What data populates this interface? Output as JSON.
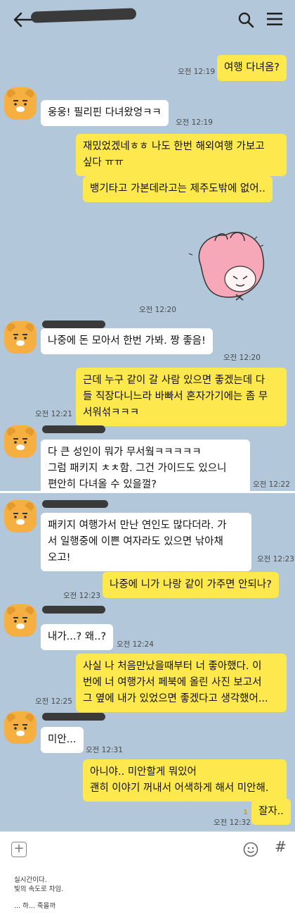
{
  "colors": {
    "chat_background": "#b2c7d9",
    "my_bubble": "#fde84d",
    "their_bubble": "#ffffff",
    "avatar": "#f5b041"
  },
  "header": {
    "back_icon": "arrow-left",
    "search_icon": "search",
    "menu_icon": "hamburger"
  },
  "messages": [
    {
      "id": "m1",
      "from": "me",
      "text": "여행 다녀옴?",
      "time": "오전 12:19"
    },
    {
      "id": "m2",
      "from": "them",
      "text": "웅웅! 필리핀 다녀왔엉ㅋㅋ",
      "time": "오전 12:19"
    },
    {
      "id": "m3",
      "from": "me",
      "text": "재밌었겠네ㅎㅎ 나도 한번 해외여행 가보고\n싶다 ㅠㅠ"
    },
    {
      "id": "m4",
      "from": "me",
      "text": "뱅기타고 가본데라고는 제주도밖에 없어.."
    },
    {
      "id": "m5",
      "from": "me",
      "sticker": "pink-bunny-sticker",
      "time": "오전 12:20"
    },
    {
      "id": "m6",
      "from": "them",
      "text": "나중에 돈 모아서 한번 가봐. 짱 좋음!",
      "time": "오전 12:20"
    },
    {
      "id": "m7",
      "from": "me",
      "text": "근데 누구 같이 갈 사람 있으면 좋겠는데 다\n들 직장다니느라 바빠서 혼자가기에는 좀 무\n서워섞ㅋㅋㅋ",
      "time": "오전 12:21"
    },
    {
      "id": "m8",
      "from": "them",
      "text": "다 큰 성인이 뭐가 무서웤ㅋㅋㅋㅋㅋ\n그럼 패키지 ㅊㅊ함. 그건 가이드도 있으니\n편안히 다녀올 수 있을껄?",
      "time": "오전 12:22"
    },
    {
      "id": "m9",
      "from": "them",
      "text": "패키지 여행가서 만난 연인도 많다더라. 가\n서 일행중에 이쁜 여자라도 있으면 낚아채\n오고!",
      "time": "오전 12:23"
    },
    {
      "id": "m10",
      "from": "me",
      "text": "나중에 니가 나랑 같이 가주면 안되나?",
      "time": "오전 12:23"
    },
    {
      "id": "m11",
      "from": "them",
      "text": "내가...? 왜..?",
      "time": "오전 12:24"
    },
    {
      "id": "m12",
      "from": "me",
      "text": "사실 나 처음만났을때부터 너 좋아했다. 이\n번에 너 여행가서 페북에 올린 사진 보고서\n그 옆에 내가 있었으면 좋겠다고 생각했어...",
      "time": "오전 12:25"
    },
    {
      "id": "m13",
      "from": "them",
      "text": "미안...",
      "time": "오전 12:31"
    },
    {
      "id": "m14",
      "from": "me",
      "text": "아니야.. 미안할게 뭐있어\n괜히 이야기 꺼내서 어색하게 해서 미안해."
    },
    {
      "id": "m15",
      "from": "me",
      "text": "잘자..",
      "time": "오전 12:32",
      "unread": "1"
    }
  ],
  "input_bar": {
    "plus_label": "+",
    "hash_label": "#"
  },
  "caption": {
    "line1": "실시간이다.",
    "line2": "빛의 속도로 차임.",
    "line3": "... 하... 죽을까"
  }
}
